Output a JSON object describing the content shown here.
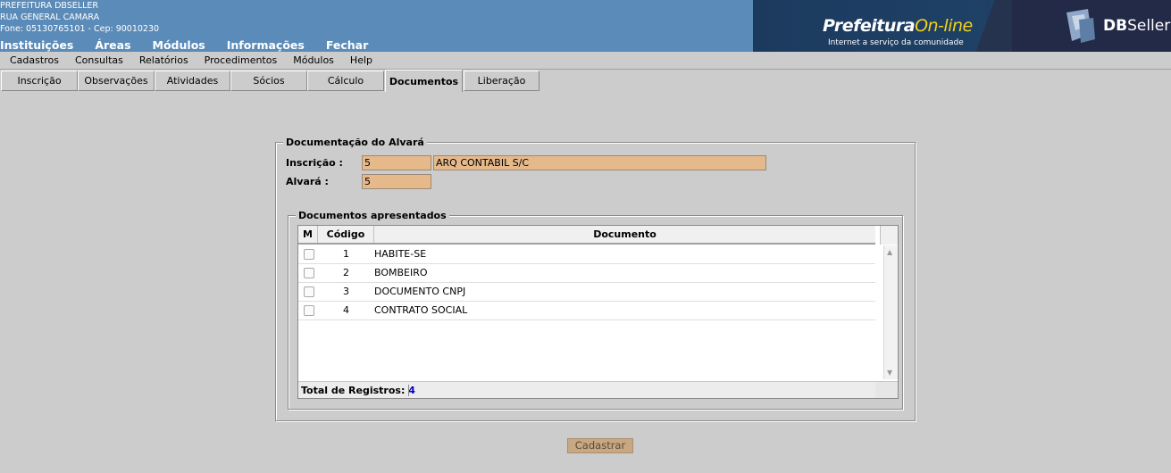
{
  "header": {
    "line1": "PREFEITURA DBSELLER",
    "line2": "RUA GENERAL CAMARA",
    "line3": "Fone: 05130765101  -  Cep: 90010230",
    "menu": [
      "Instituições",
      "Áreas",
      "Módulos",
      "Informações",
      "Fechar"
    ],
    "brand_title": "Prefeitura",
    "brand_title_accent": "On-line",
    "brand_subtitle": "Internet a serviço da comunidade",
    "brand_company_bold": "DB",
    "brand_company": "Seller",
    "colors": {
      "header_bg": "#5b8bb8",
      "brand_bg": "#1f4166",
      "accent": "#f2d21b"
    }
  },
  "menubar": [
    "Cadastros",
    "Consultas",
    "Relatórios",
    "Procedimentos",
    "Módulos",
    "Help"
  ],
  "tabs": [
    "Inscrição",
    "Observações",
    "Atividades",
    "Sócios",
    "Cálculo",
    "Documentos",
    "Liberação"
  ],
  "active_tab": "Documentos",
  "form": {
    "legend": "Documentação do Alvará",
    "inscricao_label": "Inscrição :",
    "inscricao_value": "5",
    "inscricao_name": "ARQ CONTABIL S/C",
    "alvara_label": "Alvará :",
    "alvara_value": "5"
  },
  "docs": {
    "legend": "Documentos apresentados",
    "columns": [
      "M",
      "Código",
      "Documento"
    ],
    "rows": [
      {
        "checked": false,
        "codigo": "1",
        "documento": "HABITE-SE"
      },
      {
        "checked": false,
        "codigo": "2",
        "documento": "BOMBEIRO"
      },
      {
        "checked": false,
        "codigo": "3",
        "documento": "DOCUMENTO CNPJ"
      },
      {
        "checked": false,
        "codigo": "4",
        "documento": "CONTRATO SOCIAL"
      }
    ],
    "total_label": "Total de Registros:",
    "total_value": "4"
  },
  "submit_label": "Cadastrar",
  "field_color": "#e6b98a"
}
